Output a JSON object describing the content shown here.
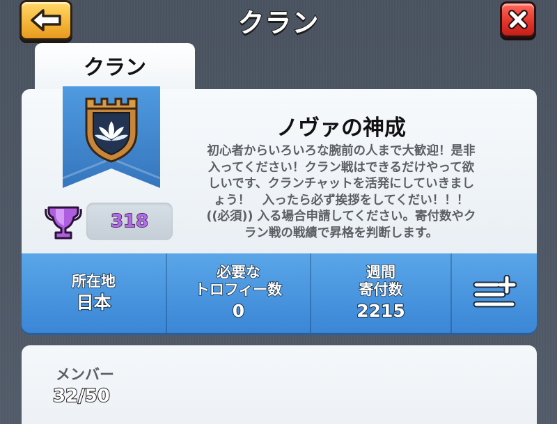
{
  "header": {
    "title": "クラン",
    "back_icon": "arrow-left-icon",
    "close_icon": "close-icon"
  },
  "tabs": [
    {
      "label": "クラン",
      "active": true
    }
  ],
  "clan": {
    "name": "ノヴァの神成",
    "badge_icon": "castle-lotus-badge-icon",
    "trophies": "318",
    "description_lines": [
      "初心者からいろいろな腕前の人まで大歓迎！是非",
      "入ってください！クラン戦はできるだけやって欲",
      "しいです、クランチャットを活発にしていきまし",
      "ょう！　入ったら必ず挨拶をしてくだい！！！",
      "((必須)) 入る場合申請してください。寄付数やク",
      "ラン戦の戦績で昇格を判断します。"
    ]
  },
  "stats": {
    "location_label": "所在地",
    "location_value": "日本",
    "required_label_line1": "必要な",
    "required_label_line2": "トロフィー数",
    "required_value": "0",
    "donations_label_line1": "週間",
    "donations_label_line2": "寄付数",
    "donations_value": "2215",
    "menu_icon": "list-add-icon"
  },
  "members": {
    "label": "メンバー",
    "value": "32/50"
  },
  "colors": {
    "back_button": "#f6b73a",
    "close_button": "#e2332a",
    "stats_bar": "#4a96de",
    "trophy_text": "#b36be8",
    "banner_blue": "#3f87cf"
  }
}
